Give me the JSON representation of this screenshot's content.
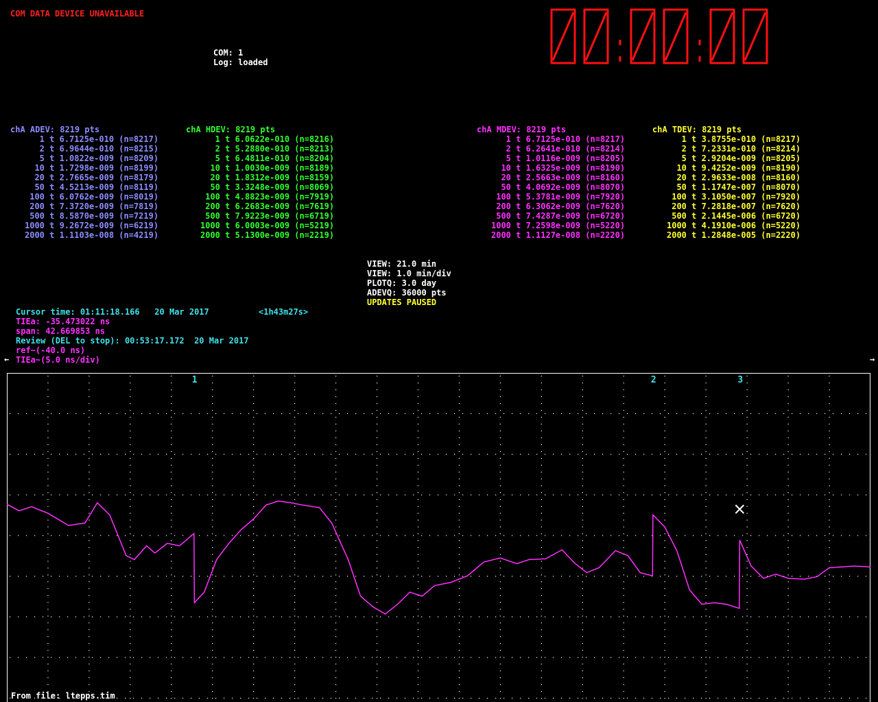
{
  "status": "COM DATA DEVICE UNAVAILABLE",
  "clock": "00:00:00",
  "com_line": "COM: 1",
  "log_line": "Log: loaded",
  "tables": [
    {
      "id": "adev",
      "header": "chA ADEV: 8219 pts",
      "color": "#8c8cff",
      "rows": [
        "   1 t 6.7125e-010 (n=8217)",
        "   2 t 6.9644e-010 (n=8215)",
        "   5 t 1.0822e-009 (n=8209)",
        "  10 t 1.7298e-009 (n=8199)",
        "  20 t 2.7665e-009 (n=8179)",
        "  50 t 4.5213e-009 (n=8119)",
        " 100 t 6.0762e-009 (n=8019)",
        " 200 t 7.3720e-009 (n=7819)",
        " 500 t 8.5870e-009 (n=7219)",
        "1000 t 9.2672e-009 (n=6219)",
        "2000 t 1.1103e-008 (n=4219)"
      ]
    },
    {
      "id": "hdev",
      "header": "chA HDEV: 8219 pts",
      "color": "#30ff30",
      "rows": [
        "   1 t 6.0622e-010 (n=8216)",
        "   2 t 5.2880e-010 (n=8213)",
        "   5 t 6.4811e-010 (n=8204)",
        "  10 t 1.0030e-009 (n=8189)",
        "  20 t 1.8312e-009 (n=8159)",
        "  50 t 3.3248e-009 (n=8069)",
        " 100 t 4.8823e-009 (n=7919)",
        " 200 t 6.2683e-009 (n=7619)",
        " 500 t 7.9223e-009 (n=6719)",
        "1000 t 6.0003e-009 (n=5219)",
        "2000 t 5.1300e-009 (n=2219)"
      ]
    },
    {
      "id": "mdev",
      "header": "chA MDEV: 8219 pts",
      "color": "#ff30ff",
      "rows": [
        "   1 t 6.7125e-010 (n=8217)",
        "   2 t 6.2641e-010 (n=8214)",
        "   5 t 1.0116e-009 (n=8205)",
        "  10 t 1.6325e-009 (n=8190)",
        "  20 t 2.5663e-009 (n=8160)",
        "  50 t 4.0692e-009 (n=8070)",
        " 100 t 5.3781e-009 (n=7920)",
        " 200 t 6.3062e-009 (n=7620)",
        " 500 t 7.4287e-009 (n=6720)",
        "1000 t 7.2598e-009 (n=5220)",
        "2000 t 1.1127e-008 (n=2220)"
      ]
    },
    {
      "id": "tdev",
      "header": "chA TDEV: 8219 pts",
      "color": "#ffff30",
      "rows": [
        "   1 t 3.8755e-010 (n=8217)",
        "   2 t 7.2331e-010 (n=8214)",
        "   5 t 2.9204e-009 (n=8205)",
        "  10 t 9.4252e-009 (n=8190)",
        "  20 t 2.9633e-008 (n=8160)",
        "  50 t 1.1747e-007 (n=8070)",
        " 100 t 3.1050e-007 (n=7920)",
        " 200 t 7.2818e-007 (n=7620)",
        " 500 t 2.1445e-006 (n=6720)",
        "1000 t 4.1910e-006 (n=5220)",
        "2000 t 1.2848e-005 (n=2220)"
      ]
    }
  ],
  "view": {
    "view_min": "VIEW: 21.0 min",
    "view_div": "VIEW: 1.0 min/div",
    "plotq": "PLOTQ: 3.0 day",
    "adevq": "ADEVQ: 36000 pts",
    "paused": "UPDATES PAUSED"
  },
  "cursor": {
    "time": "Cursor time: 01:11:18.166   20 Mar 2017",
    "elapsed": "<1h43m27s>",
    "tiea": "TIEa: -35.473022 ns",
    "span": "span: 42.669853 ns",
    "review": "Review (DEL to stop): 00:53:17.172  20 Mar 2017",
    "ref": "ref~(-40.0 ns)",
    "scale": "TIEa~(5.0 ns/div)"
  },
  "markers": [
    "1",
    "2",
    "3"
  ],
  "footer": "From file: ltepps.tim",
  "colors": {
    "trace": "#ff30ff",
    "grid": "#ffffff",
    "marker": "#3fe0e8",
    "clock": "#ff1010"
  },
  "icons": {
    "left_arrow": "arrow-left-icon",
    "right_arrow": "arrow-right-icon",
    "cursor": "x-cursor-icon"
  },
  "chart_data": {
    "type": "line",
    "x_unit": "min",
    "x_range": [
      0,
      21
    ],
    "y_unit": "ns",
    "y_ref": -40.0,
    "y_per_div": 5.0,
    "series": [
      {
        "values_ns": [
          [
            0.0,
            -31.2
          ],
          [
            0.3,
            -32.0
          ],
          [
            0.6,
            -31.5
          ],
          [
            1.0,
            -32.3
          ],
          [
            1.5,
            -33.8
          ],
          [
            1.9,
            -33.5
          ],
          [
            2.2,
            -31.0
          ],
          [
            2.5,
            -32.5
          ],
          [
            2.9,
            -37.5
          ],
          [
            3.1,
            -38.0
          ],
          [
            3.4,
            -36.3
          ],
          [
            3.6,
            -37.2
          ],
          [
            3.9,
            -36.0
          ],
          [
            4.2,
            -36.3
          ],
          [
            4.55,
            -34.8
          ],
          [
            4.56,
            -43.3
          ],
          [
            4.8,
            -42.0
          ],
          [
            5.1,
            -38.0
          ],
          [
            5.4,
            -36.0
          ],
          [
            5.7,
            -34.3
          ],
          [
            6.0,
            -33.0
          ],
          [
            6.3,
            -31.3
          ],
          [
            6.6,
            -30.8
          ],
          [
            6.9,
            -31.0
          ],
          [
            7.2,
            -31.3
          ],
          [
            7.6,
            -31.6
          ],
          [
            7.9,
            -33.5
          ],
          [
            8.3,
            -38.0
          ],
          [
            8.6,
            -42.5
          ],
          [
            8.9,
            -43.8
          ],
          [
            9.2,
            -44.7
          ],
          [
            9.5,
            -43.5
          ],
          [
            9.8,
            -42.0
          ],
          [
            10.1,
            -42.5
          ],
          [
            10.4,
            -41.2
          ],
          [
            10.8,
            -40.8
          ],
          [
            11.2,
            -40.0
          ],
          [
            11.6,
            -38.3
          ],
          [
            12.0,
            -37.8
          ],
          [
            12.4,
            -38.5
          ],
          [
            12.7,
            -38.0
          ],
          [
            13.1,
            -37.9
          ],
          [
            13.5,
            -36.8
          ],
          [
            13.8,
            -38.4
          ],
          [
            14.1,
            -39.6
          ],
          [
            14.4,
            -39.0
          ],
          [
            14.8,
            -36.9
          ],
          [
            15.1,
            -37.5
          ],
          [
            15.4,
            -39.6
          ],
          [
            15.7,
            -40.0
          ],
          [
            15.71,
            -32.5
          ],
          [
            16.0,
            -34.0
          ],
          [
            16.3,
            -37.0
          ],
          [
            16.6,
            -41.7
          ],
          [
            16.9,
            -43.5
          ],
          [
            17.2,
            -43.3
          ],
          [
            17.5,
            -43.5
          ],
          [
            17.81,
            -44.0
          ],
          [
            17.82,
            -35.6
          ],
          [
            18.1,
            -38.8
          ],
          [
            18.4,
            -40.3
          ],
          [
            18.7,
            -39.8
          ],
          [
            19.0,
            -40.3
          ],
          [
            19.4,
            -40.4
          ],
          [
            19.7,
            -40.1
          ],
          [
            20.0,
            -39.0
          ],
          [
            20.3,
            -38.9
          ],
          [
            20.6,
            -38.8
          ],
          [
            21.0,
            -38.9
          ]
        ]
      }
    ],
    "markers_min": [
      4.55,
      15.71,
      17.82
    ],
    "cursor_min": 17.82,
    "cursor_ns": -31.8
  }
}
